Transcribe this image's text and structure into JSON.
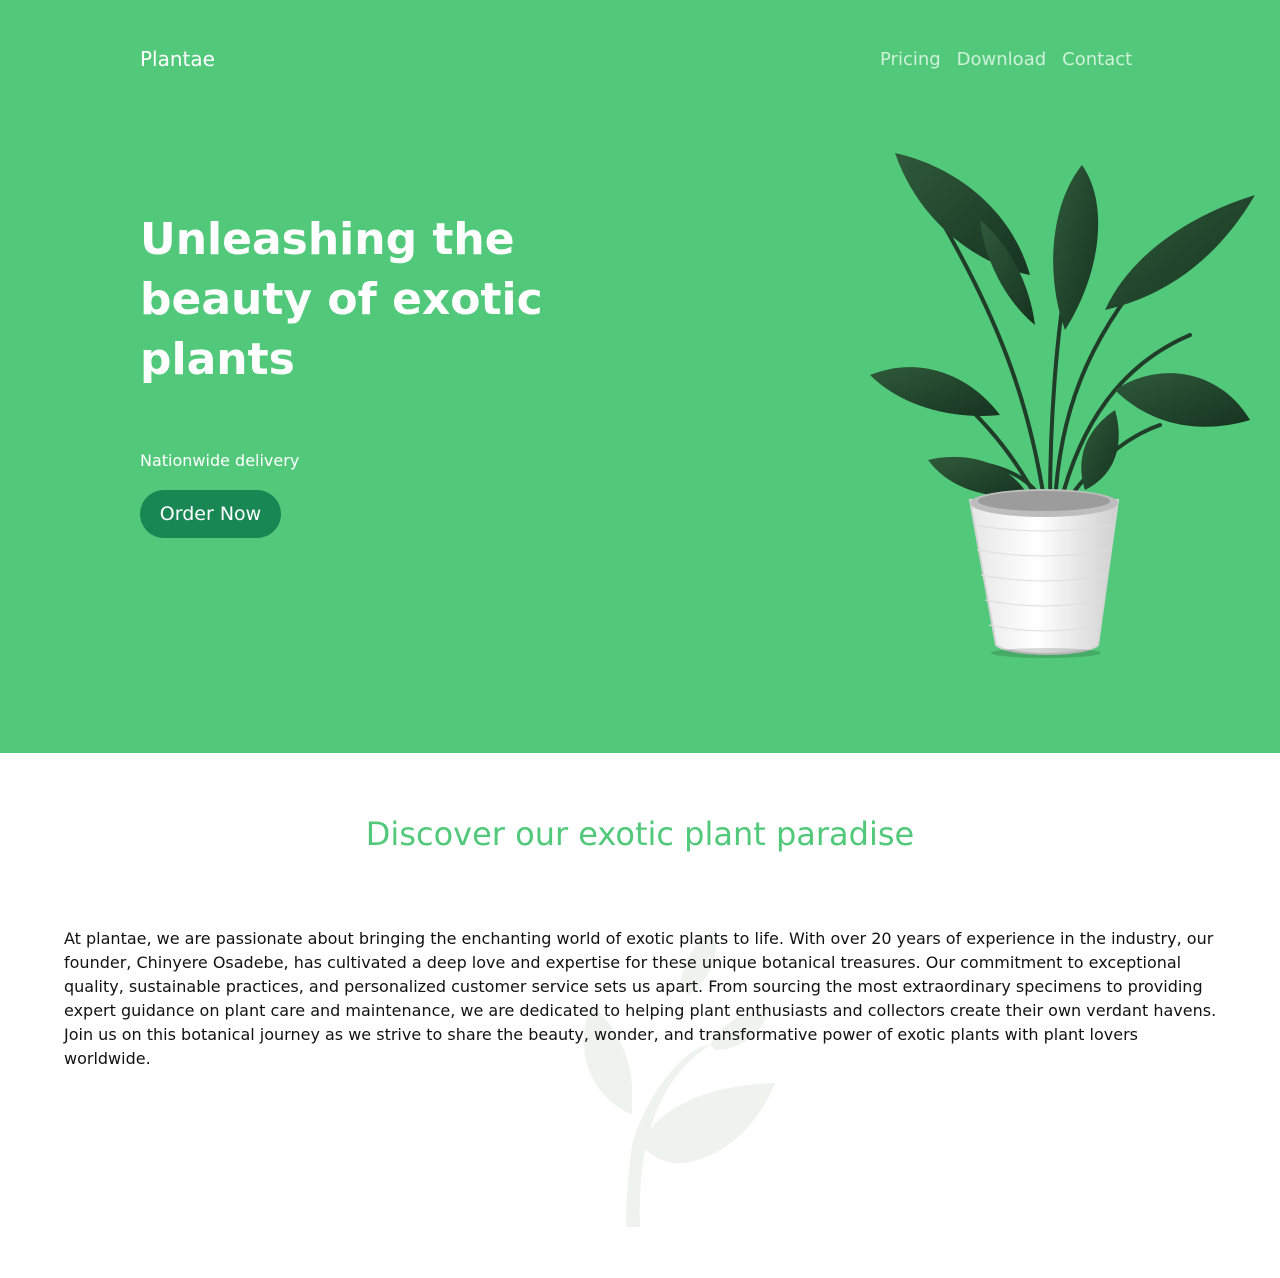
{
  "header": {
    "brand": "Plantae",
    "nav": [
      "Pricing",
      "Download",
      "Contact"
    ]
  },
  "hero": {
    "title": "Unleashing the beauty of exotic plants",
    "subtitle": "Nationwide delivery",
    "cta_label": "Order Now",
    "image_icon": "potted-plant-icon"
  },
  "about": {
    "heading": "Discover our exotic plant paradise",
    "body": "At plantae, we are passionate about bringing the enchanting world of exotic plants to life. With over 20 years of experience in the industry, our founder, Chinyere Osadebe, has cultivated a deep love and expertise for these unique botanical treasures. Our commitment to exceptional quality, sustainable practices, and personalized customer service sets us apart. From sourcing the most extraordinary specimens to providing expert guidance on plant care and maintenance, we are dedicated to helping plant enthusiasts and collectors create their own verdant havens. Join us on this botanical journey as we strive to share the beauty, wonder, and transformative power of exotic plants with plant lovers worldwide.",
    "watermark_icon": "leaf-sprout-icon"
  },
  "colors": {
    "hero_bg": "#52c97a",
    "button_bg": "#198754",
    "accent": "#52c97a"
  }
}
